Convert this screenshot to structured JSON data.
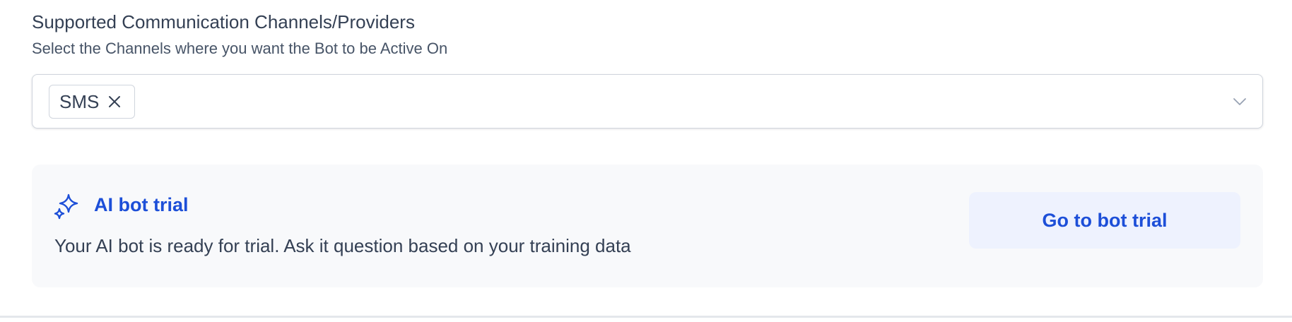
{
  "channels": {
    "title": "Supported Communication Channels/Providers",
    "description": "Select the Channels where you want the Bot to be Active On",
    "selected": [
      {
        "label": "SMS",
        "remove_icon": "close-icon"
      }
    ],
    "dropdown_icon": "chevron-down-icon"
  },
  "trial": {
    "icon": "sparkles-icon",
    "title": "AI bot trial",
    "description": "Your AI bot is ready for trial. Ask it question based on your training data",
    "button_label": "Go to bot trial"
  },
  "colors": {
    "accent": "#1d4fd8",
    "text": "#344054",
    "border": "#d0d5dd",
    "trial_background": "#f8f9fb",
    "button_background": "#eef2fe"
  }
}
